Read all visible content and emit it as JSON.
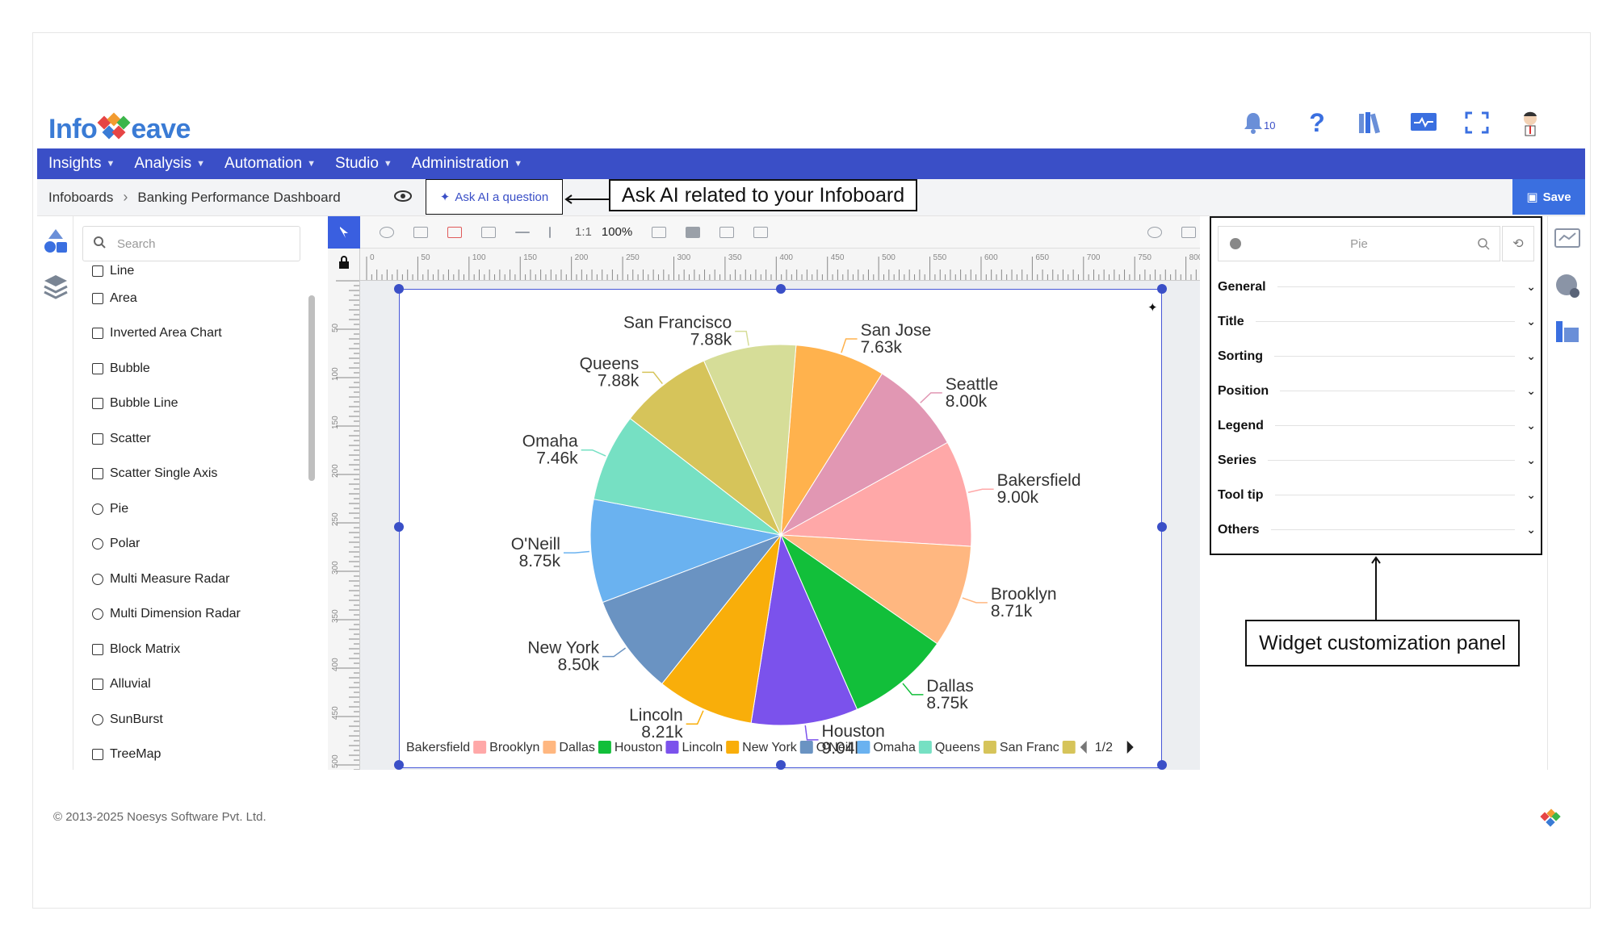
{
  "brand": {
    "name_left": "Info",
    "name_right": "eave"
  },
  "header": {
    "notification_count": "10"
  },
  "nav": [
    {
      "label": "Insights"
    },
    {
      "label": "Analysis"
    },
    {
      "label": "Automation"
    },
    {
      "label": "Studio"
    },
    {
      "label": "Administration"
    }
  ],
  "breadcrumb": {
    "root": "Infoboards",
    "current": "Banking Performance Dashboard"
  },
  "ask_ai": {
    "label": "Ask AI a question"
  },
  "save": {
    "label": "Save"
  },
  "annotations": {
    "ask_ai_note": "Ask AI related to your Infoboard",
    "panel_note": "Widget customization panel"
  },
  "widget_search": {
    "placeholder": "Search"
  },
  "widget_items": [
    "Line",
    "Area",
    "Inverted Area Chart",
    "Bubble",
    "Bubble Line",
    "Scatter",
    "Scatter Single Axis",
    "Pie",
    "Polar",
    "Multi Measure Radar",
    "Multi Dimension Radar",
    "Block Matrix",
    "Alluvial",
    "SunBurst",
    "TreeMap"
  ],
  "toolbar": {
    "ratio": "1:1",
    "zoom": "100%"
  },
  "ruler_h": [
    "0",
    "50",
    "100",
    "150",
    "200",
    "250",
    "300",
    "350",
    "400",
    "450",
    "500",
    "550",
    "600",
    "650",
    "700",
    "750",
    "800"
  ],
  "ruler_v": [
    "50",
    "100",
    "150",
    "200",
    "250",
    "300",
    "350",
    "400",
    "450",
    "500"
  ],
  "props": {
    "search_value": "Pie",
    "sections": [
      "General",
      "Title",
      "Sorting",
      "Position",
      "Legend",
      "Series",
      "Tool tip",
      "Others"
    ]
  },
  "legend_pager": "1/2",
  "footer": {
    "copyright": "© 2013-2025 Noesys Software Pvt. Ltd."
  },
  "chart_data": {
    "type": "pie",
    "slices": [
      {
        "label": "San Jose",
        "value": 7.63,
        "display": "7.63k",
        "color": "#ffb24d"
      },
      {
        "label": "Seattle",
        "value": 8.0,
        "display": "8.00k",
        "color": "#e197b3"
      },
      {
        "label": "Bakersfield",
        "value": 9.0,
        "display": "9.00k",
        "color": "#ffa8a8"
      },
      {
        "label": "Brooklyn",
        "value": 8.71,
        "display": "8.71k",
        "color": "#ffb780"
      },
      {
        "label": "Dallas",
        "value": 8.75,
        "display": "8.75k",
        "color": "#12bf3a"
      },
      {
        "label": "Houston",
        "value": 9.04,
        "display": "9.04k",
        "color": "#7b52ec"
      },
      {
        "label": "Lincoln",
        "value": 8.21,
        "display": "8.21k",
        "color": "#f9ae0a"
      },
      {
        "label": "New York",
        "value": 8.5,
        "display": "8.50k",
        "color": "#6a93c2"
      },
      {
        "label": "O'Neill",
        "value": 8.75,
        "display": "8.75k",
        "color": "#6ab2f0"
      },
      {
        "label": "Omaha",
        "value": 7.46,
        "display": "7.46k",
        "color": "#76e0c3"
      },
      {
        "label": "Queens",
        "value": 7.88,
        "display": "7.88k",
        "color": "#d6c45a"
      },
      {
        "label": "San Francisco",
        "value": 7.88,
        "display": "7.88k",
        "color": "#d6dd98"
      }
    ],
    "legend": [
      {
        "label": "Bakersfield",
        "color": "#ffa8a8"
      },
      {
        "label": "Brooklyn",
        "color": "#ffb780"
      },
      {
        "label": "Dallas",
        "color": "#12bf3a"
      },
      {
        "label": "Houston",
        "color": "#7b52ec"
      },
      {
        "label": "Lincoln",
        "color": "#f9ae0a"
      },
      {
        "label": "New York",
        "color": "#6a93c2"
      },
      {
        "label": "O'Neill",
        "color": "#6ab2f0"
      },
      {
        "label": "Omaha",
        "color": "#76e0c3"
      },
      {
        "label": "Queens",
        "color": "#d6c45a"
      },
      {
        "label": "San Franc",
        "color": "#d6c45a"
      }
    ]
  }
}
